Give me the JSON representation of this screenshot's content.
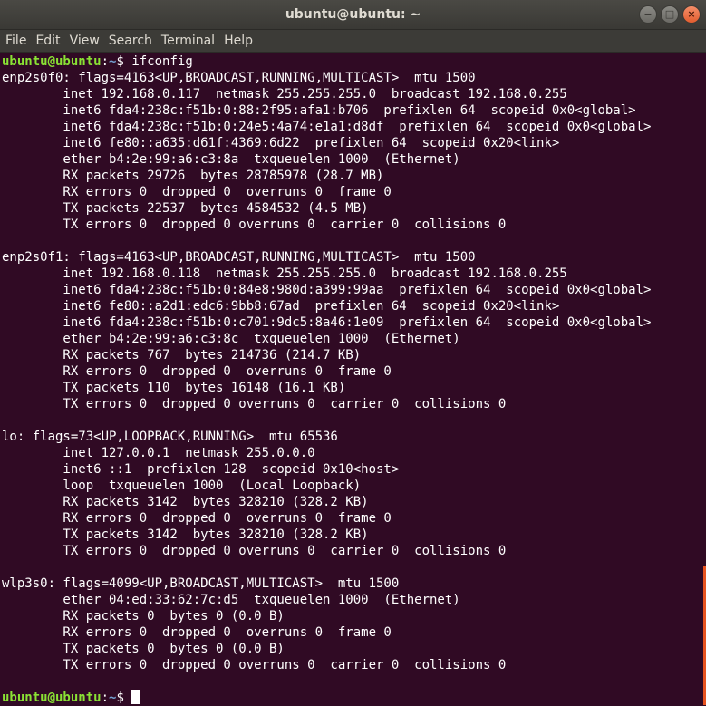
{
  "window": {
    "title": "ubuntu@ubuntu: ~",
    "controls": {
      "minimize": "−",
      "maximize": "□",
      "close": "×"
    }
  },
  "menu": [
    "File",
    "Edit",
    "View",
    "Search",
    "Terminal",
    "Help"
  ],
  "prompt": {
    "user_host": "ubuntu@ubuntu",
    "path": "~",
    "symbol": "$ "
  },
  "command": "ifconfig",
  "output": [
    "enp2s0f0: flags=4163<UP,BROADCAST,RUNNING,MULTICAST>  mtu 1500",
    "        inet 192.168.0.117  netmask 255.255.255.0  broadcast 192.168.0.255",
    "        inet6 fda4:238c:f51b:0:88:2f95:afa1:b706  prefixlen 64  scopeid 0x0<global>",
    "        inet6 fda4:238c:f51b:0:24e5:4a74:e1a1:d8df  prefixlen 64  scopeid 0x0<global>",
    "        inet6 fe80::a635:d61f:4369:6d22  prefixlen 64  scopeid 0x20<link>",
    "        ether b4:2e:99:a6:c3:8a  txqueuelen 1000  (Ethernet)",
    "        RX packets 29726  bytes 28785978 (28.7 MB)",
    "        RX errors 0  dropped 0  overruns 0  frame 0",
    "        TX packets 22537  bytes 4584532 (4.5 MB)",
    "        TX errors 0  dropped 0 overruns 0  carrier 0  collisions 0",
    "",
    "enp2s0f1: flags=4163<UP,BROADCAST,RUNNING,MULTICAST>  mtu 1500",
    "        inet 192.168.0.118  netmask 255.255.255.0  broadcast 192.168.0.255",
    "        inet6 fda4:238c:f51b:0:84e8:980d:a399:99aa  prefixlen 64  scopeid 0x0<global>",
    "        inet6 fe80::a2d1:edc6:9bb8:67ad  prefixlen 64  scopeid 0x20<link>",
    "        inet6 fda4:238c:f51b:0:c701:9dc5:8a46:1e09  prefixlen 64  scopeid 0x0<global>",
    "        ether b4:2e:99:a6:c3:8c  txqueuelen 1000  (Ethernet)",
    "        RX packets 767  bytes 214736 (214.7 KB)",
    "        RX errors 0  dropped 0  overruns 0  frame 0",
    "        TX packets 110  bytes 16148 (16.1 KB)",
    "        TX errors 0  dropped 0 overruns 0  carrier 0  collisions 0",
    "",
    "lo: flags=73<UP,LOOPBACK,RUNNING>  mtu 65536",
    "        inet 127.0.0.1  netmask 255.0.0.0",
    "        inet6 ::1  prefixlen 128  scopeid 0x10<host>",
    "        loop  txqueuelen 1000  (Local Loopback)",
    "        RX packets 3142  bytes 328210 (328.2 KB)",
    "        RX errors 0  dropped 0  overruns 0  frame 0",
    "        TX packets 3142  bytes 328210 (328.2 KB)",
    "        TX errors 0  dropped 0 overruns 0  carrier 0  collisions 0",
    "",
    "wlp3s0: flags=4099<UP,BROADCAST,MULTICAST>  mtu 1500",
    "        ether 04:ed:33:62:7c:d5  txqueuelen 1000  (Ethernet)",
    "        RX packets 0  bytes 0 (0.0 B)",
    "        RX errors 0  dropped 0  overruns 0  frame 0",
    "        TX packets 0  bytes 0 (0.0 B)",
    "        TX errors 0  dropped 0 overruns 0  carrier 0  collisions 0",
    ""
  ],
  "colors": {
    "background": "#300a24",
    "user_host": "#8ae234",
    "path": "#729fcf",
    "text": "#ffffff",
    "accent": "#e95420"
  }
}
